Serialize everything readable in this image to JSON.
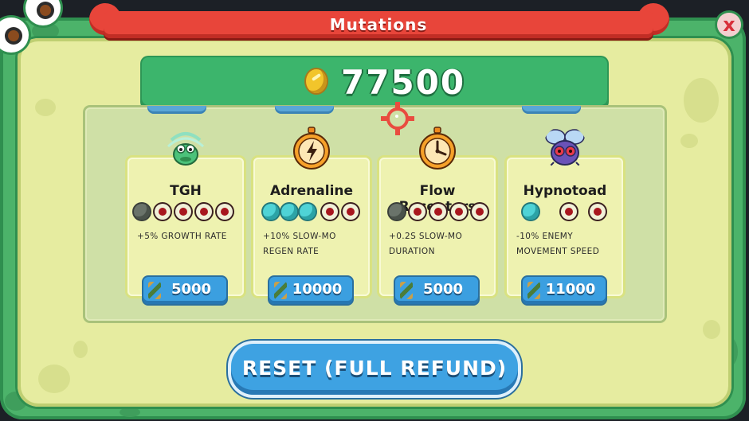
{
  "screen": {
    "title": "Mutations",
    "close_label": "x"
  },
  "currency": {
    "icon": "coin-icon",
    "value": "77500"
  },
  "mutations": [
    {
      "name": "TGH",
      "icon": "frog-icon",
      "levels_owned": 1,
      "levels_total": 5,
      "description": "+5% GROWTH RATE",
      "price": "5000"
    },
    {
      "name": "Adrenaline",
      "icon": "lightning-stopwatch-icon",
      "levels_owned": 3,
      "levels_total": 5,
      "description": "+10% SLOW-MO REGEN RATE",
      "price": "10000"
    },
    {
      "name": "Flow Receptors",
      "icon": "stopwatch-icon",
      "levels_owned": 1,
      "levels_total": 5,
      "description": "+0.2S SLOW-MO DURATION",
      "price": "5000"
    },
    {
      "name": "Hypnotoad",
      "icon": "fly-icon",
      "levels_owned": 1,
      "levels_total": 3,
      "description": "-10% ENEMY MOVEMENT SPEED",
      "price": "11000"
    }
  ],
  "reset_button": {
    "label": "RESET (FULL REFUND)"
  },
  "colors": {
    "frame_green": "#4cb36a",
    "panel_yellow": "#e6eca0",
    "banner_red": "#e8453a",
    "button_blue": "#3b9fe0",
    "owned_cyan": "#4fd3d6",
    "locked_red": "#a8161e"
  }
}
